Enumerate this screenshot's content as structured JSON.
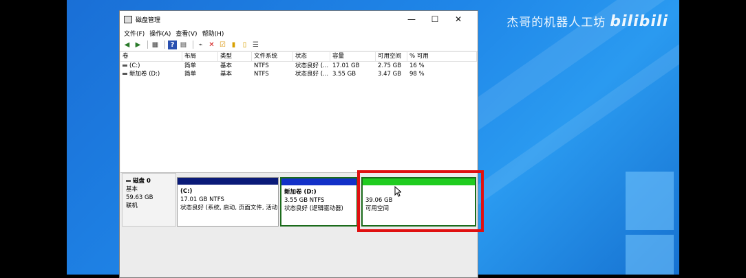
{
  "watermark": {
    "text": "杰哥的机器人工坊",
    "logo": "bilibili"
  },
  "window": {
    "title": "磁盘管理",
    "controls": {
      "minimize": "—",
      "maximize": "☐",
      "close": "✕"
    }
  },
  "menu": [
    "文件(F)",
    "操作(A)",
    "查看(V)",
    "帮助(H)"
  ],
  "toolbar": [
    "back-icon",
    "forward-icon",
    "disk-list-icon",
    "help-icon",
    "properties-icon",
    "connect-icon",
    "delete-icon",
    "check-icon",
    "new-icon",
    "import-icon",
    "list-icon"
  ],
  "volumes": {
    "columns": [
      "卷",
      "布局",
      "类型",
      "文件系统",
      "状态",
      "容量",
      "可用空间",
      "% 可用"
    ],
    "rows": [
      [
        "(C:)",
        "简单",
        "基本",
        "NTFS",
        "状态良好 (...",
        "17.01 GB",
        "2.75 GB",
        "16 %"
      ],
      [
        "新加卷 (D:)",
        "简单",
        "基本",
        "NTFS",
        "状态良好 (...",
        "3.55 GB",
        "3.47 GB",
        "98 %"
      ]
    ]
  },
  "disk": {
    "name": "磁盘 0",
    "type": "基本",
    "size": "59.63 GB",
    "status": "联机",
    "partitions": [
      {
        "name": "(C:)",
        "size": "17.01 GB NTFS",
        "status": "状态良好 (系统, 启动, 页面文件, 活动"
      },
      {
        "name": "新加卷 (D:)",
        "size": "3.55 GB NTFS",
        "status": "状态良好 (逻辑驱动器)"
      },
      {
        "name": "",
        "size": "39.06 GB",
        "status": "可用空间"
      }
    ]
  },
  "colors": {
    "primary_partition": "#0a1a78",
    "logical_drive": "#1230c8",
    "free_space": "#1fcc1f",
    "highlight": "#e01010"
  }
}
